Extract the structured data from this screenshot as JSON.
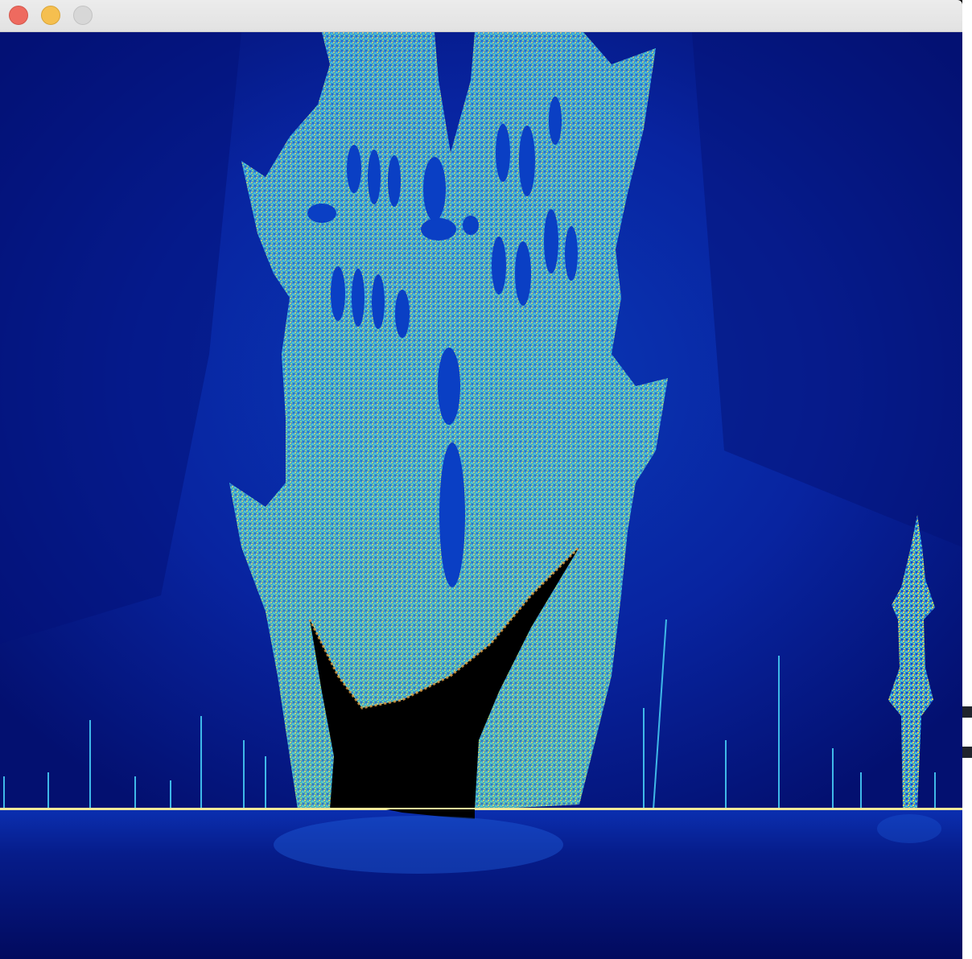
{
  "window": {
    "title": "",
    "controls": {
      "close": "close",
      "minimize": "minimize",
      "zoom": "zoom"
    }
  },
  "render": {
    "palette": {
      "background_deep": "#020a5e",
      "background_mid": "#0a2aa8",
      "glow_blue": "#1e5ad8",
      "cyan": "#3fb8e8",
      "yellow": "#e6d85a",
      "orange": "#e07a2a",
      "set_interior": "#000000",
      "horizon_line": "#f0e89a"
    }
  }
}
